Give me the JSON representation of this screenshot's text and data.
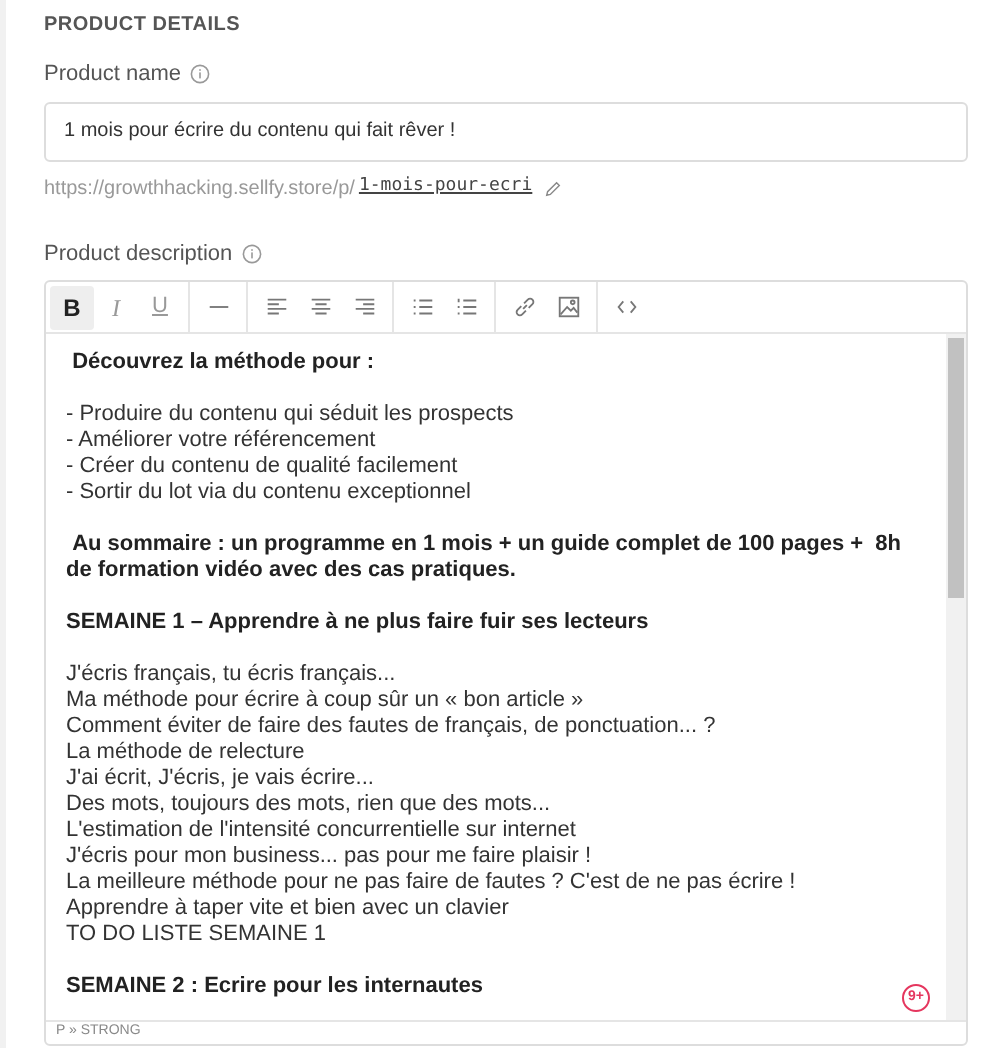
{
  "section_title": "PRODUCT DETAILS",
  "product_name": {
    "label": "Product name",
    "value": "1 mois pour écrire du contenu qui fait rêver !"
  },
  "url": {
    "prefix": "https://growthhacking.sellfy.store/p/",
    "slug": "1-mois-pour-ecri"
  },
  "description": {
    "label": "Product description",
    "toolbar": [
      {
        "kind": "bold",
        "text": "B",
        "active": true
      },
      {
        "kind": "italic",
        "text": "I",
        "active": false
      },
      {
        "kind": "underline",
        "text": "U",
        "active": false
      },
      {
        "kind": "sep"
      },
      {
        "kind": "hr"
      },
      {
        "kind": "sep"
      },
      {
        "kind": "align-left"
      },
      {
        "kind": "align-center"
      },
      {
        "kind": "align-right"
      },
      {
        "kind": "sep"
      },
      {
        "kind": "bullets"
      },
      {
        "kind": "numbers"
      },
      {
        "kind": "sep"
      },
      {
        "kind": "link"
      },
      {
        "kind": "image"
      },
      {
        "kind": "sep"
      },
      {
        "kind": "code"
      }
    ],
    "paragraphs": [
      {
        "kind": "bold",
        "text": " Découvrez la méthode pour :"
      },
      {
        "kind": "blank"
      },
      {
        "kind": "normal",
        "text": "- Produire du contenu qui séduit les prospects"
      },
      {
        "kind": "normal",
        "text": "- Améliorer votre référencement"
      },
      {
        "kind": "normal",
        "text": "- Créer du contenu de qualité facilement"
      },
      {
        "kind": "normal",
        "text": "- Sortir du lot via du contenu exceptionnel"
      },
      {
        "kind": "blank"
      },
      {
        "kind": "bold",
        "text": " Au sommaire : un programme en 1 mois + un guide complet de 100 pages +  8h de formation vidéo avec des cas pratiques."
      },
      {
        "kind": "blank"
      },
      {
        "kind": "bold",
        "text": "SEMAINE 1 – Apprendre à ne plus faire fuir ses lecteurs"
      },
      {
        "kind": "blank"
      },
      {
        "kind": "normal",
        "text": "J'écris français, tu écris français..."
      },
      {
        "kind": "normal",
        "text": "Ma méthode pour écrire à coup sûr un « bon article »"
      },
      {
        "kind": "normal",
        "text": "Comment éviter de faire des fautes de français, de ponctuation... ?"
      },
      {
        "kind": "normal",
        "text": "La méthode de relecture"
      },
      {
        "kind": "normal",
        "text": "J'ai écrit, J'écris, je vais écrire..."
      },
      {
        "kind": "normal",
        "text": "Des mots, toujours des mots, rien que des mots..."
      },
      {
        "kind": "normal",
        "text": "L'estimation de l'intensité concurrentielle sur internet"
      },
      {
        "kind": "normal",
        "text": "J'écris pour mon business... pas pour me faire plaisir !"
      },
      {
        "kind": "normal",
        "text": "La meilleure méthode pour ne pas faire de fautes ? C'est de ne pas écrire !"
      },
      {
        "kind": "normal",
        "text": "Apprendre à taper vite et bien avec un clavier"
      },
      {
        "kind": "normal",
        "text": "TO DO LISTE SEMAINE 1"
      },
      {
        "kind": "blank"
      },
      {
        "kind": "bold",
        "text": "SEMAINE 2 : Ecrire pour les internautes"
      }
    ],
    "badge": "9+",
    "status_path": "P » STRONG"
  }
}
